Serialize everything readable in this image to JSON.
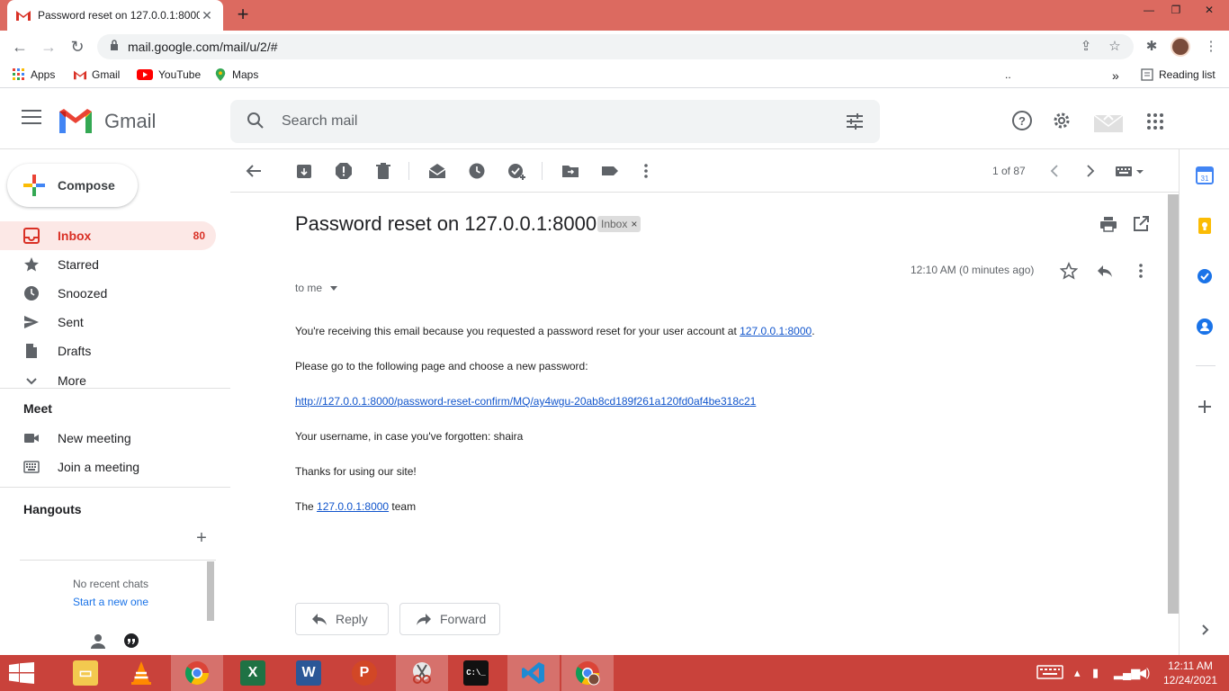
{
  "browser": {
    "tab_title": "Password reset on 127.0.0.1:8000",
    "url": "mail.google.com/mail/u/2/#",
    "bookmarks": [
      "Apps",
      "Gmail",
      "YouTube",
      "Maps"
    ],
    "bookmark_more": "..",
    "reading_list": "Reading list"
  },
  "gmail": {
    "product_name": "Gmail",
    "search_placeholder": "Search mail"
  },
  "sidebar": {
    "compose_label": "Compose",
    "items": [
      {
        "label": "Inbox",
        "count": "80"
      },
      {
        "label": "Starred"
      },
      {
        "label": "Snoozed"
      },
      {
        "label": "Sent"
      },
      {
        "label": "Drafts"
      },
      {
        "label": "More"
      }
    ],
    "meet": {
      "heading": "Meet",
      "new_meeting": "New meeting",
      "join_meeting": "Join a meeting"
    },
    "hangouts": {
      "heading": "Hangouts",
      "no_recent": "No recent chats",
      "start_new": "Start a new one"
    }
  },
  "toolbar": {
    "pager": "1 of 87"
  },
  "message": {
    "subject": "Password reset on 127.0.0.1:8000",
    "label": "Inbox",
    "time": "12:10 AM (0 minutes ago)",
    "recipient": "to me",
    "line1_text": "You're receiving this email because you requested a password reset for your user account at ",
    "line1_link": "127.0.0.1:8000",
    "line1_end": ".",
    "line2": "Please go to the following page and choose a new password:",
    "reset_link": "http://127.0.0.1:8000/password-reset-confirm/MQ/ay4wgu-20ab8cd189f261a120fd0af4be318c21",
    "line3": "Your username, in case you've forgotten: shaira",
    "line4": "Thanks for using our site!",
    "sign_pre": "The ",
    "sign_link": "127.0.0.1:8000",
    "sign_post": " team",
    "reply_label": "Reply",
    "forward_label": "Forward"
  },
  "taskbar": {
    "time": "12:11 AM",
    "date": "12/24/2021"
  },
  "colors": {
    "tabbar": "#dc6a60",
    "taskbar": "#c9423b",
    "inbox_active_bg": "#fce8e6",
    "inbox_active_text": "#d93025",
    "link": "#1155cc"
  }
}
